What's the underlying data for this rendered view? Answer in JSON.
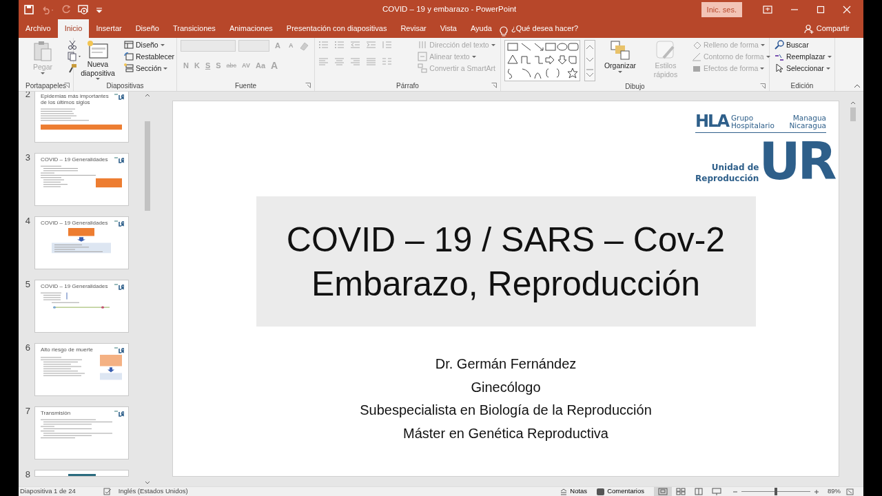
{
  "title_bar": {
    "title": "COVID – 19 y embarazo  -  PowerPoint",
    "sign_in": "Inic. ses."
  },
  "tabs": [
    {
      "label": "Archivo",
      "selected": false
    },
    {
      "label": "Inicio",
      "selected": true
    },
    {
      "label": "Insertar",
      "selected": false
    },
    {
      "label": "Diseño",
      "selected": false
    },
    {
      "label": "Transiciones",
      "selected": false
    },
    {
      "label": "Animaciones",
      "selected": false
    },
    {
      "label": "Presentación con diapositivas",
      "selected": false
    },
    {
      "label": "Revisar",
      "selected": false
    },
    {
      "label": "Vista",
      "selected": false
    },
    {
      "label": "Ayuda",
      "selected": false
    }
  ],
  "tell_me": "¿Qué desea hacer?",
  "share": "Compartir",
  "ribbon": {
    "groups": [
      {
        "kind": "clipboard",
        "label": "Portapapeles",
        "items": [
          {
            "label": "Pegar",
            "disabled": true
          }
        ]
      },
      {
        "kind": "slides",
        "label": "Diapositivas",
        "items": [
          {
            "label": "Nueva diapositiva",
            "disabled": false
          },
          {
            "label": "Diseño",
            "disabled": false
          },
          {
            "label": "Restablecer",
            "disabled": false
          },
          {
            "label": "Sección",
            "disabled": false
          }
        ]
      },
      {
        "kind": "font",
        "label": "Fuente",
        "items": [
          {
            "label": "A",
            "disabled": true
          },
          {
            "label": "A",
            "disabled": true
          },
          {
            "label": "N",
            "disabled": true
          },
          {
            "label": "K",
            "disabled": true
          },
          {
            "label": "S",
            "disabled": true
          },
          {
            "label": "S",
            "disabled": true
          },
          {
            "label": "abc",
            "disabled": true
          },
          {
            "label": "AV",
            "disabled": true
          },
          {
            "label": "Aa",
            "disabled": true
          },
          {
            "label": "A",
            "disabled": true
          }
        ]
      },
      {
        "kind": "paragraph",
        "label": "Párrafo",
        "items": [
          {
            "label": "Dirección del texto",
            "disabled": true
          },
          {
            "label": "Alinear texto",
            "disabled": true
          },
          {
            "label": "Convertir a SmartArt",
            "disabled": true
          }
        ]
      },
      {
        "kind": "drawing",
        "label": "Dibujo",
        "items": [
          {
            "label": "Organizar",
            "disabled": false
          },
          {
            "label": "Estilos rápidos",
            "disabled": true
          },
          {
            "label": "Relleno de forma",
            "disabled": true
          },
          {
            "label": "Contorno de forma",
            "disabled": true
          },
          {
            "label": "Efectos de forma",
            "disabled": true
          }
        ]
      },
      {
        "kind": "editing",
        "label": "Edición",
        "items": [
          {
            "label": "Buscar",
            "disabled": false
          },
          {
            "label": "Reemplazar",
            "disabled": false
          },
          {
            "label": "Seleccionar",
            "disabled": false
          }
        ]
      }
    ]
  },
  "thumbnails": [
    {
      "number": "2",
      "title": "Epidemias más importantes de los últimos siglos",
      "kind": "banner"
    },
    {
      "number": "3",
      "title": "COVID – 19 Generalidades",
      "kind": "box-right"
    },
    {
      "number": "4",
      "title": "COVID – 19 Generalidades",
      "kind": "flow"
    },
    {
      "number": "5",
      "title": "COVID – 19 Generalidades",
      "kind": "timeline"
    },
    {
      "number": "6",
      "title": "Alto riesgo de muerte",
      "kind": "flow-right"
    },
    {
      "number": "7",
      "title": "Transmisión",
      "kind": "list"
    },
    {
      "number": "8",
      "kind": "cut"
    }
  ],
  "slide": {
    "logo": {
      "hla": "HLA",
      "group_lines": [
        "Grupo",
        "Hospitalario"
      ],
      "city_lines": [
        "Managua",
        "Nicaragua"
      ],
      "unit_lines": [
        "Unidad de",
        "Reproducción"
      ],
      "mark": "UR"
    },
    "title_lines": [
      "COVID – 19 / SARS – Cov-2",
      "Embarazo, Reproducción"
    ],
    "subtitle_lines": [
      "Dr. Germán Fernández",
      "Ginecólogo",
      "Subespecialista en Biología de la Reproducción",
      "Máster en Genética Reproductiva"
    ]
  },
  "status_bar": {
    "slide_counter": "Diapositiva 1 de 24",
    "language": "Inglés (Estados Unidos)",
    "notes": "Notas",
    "comments": "Comentarios",
    "views": [
      {
        "selected": true
      },
      {
        "selected": false
      },
      {
        "selected": false
      },
      {
        "selected": false
      }
    ],
    "zoom_slider": {
      "level": 0.5
    },
    "zoom": "89%"
  }
}
